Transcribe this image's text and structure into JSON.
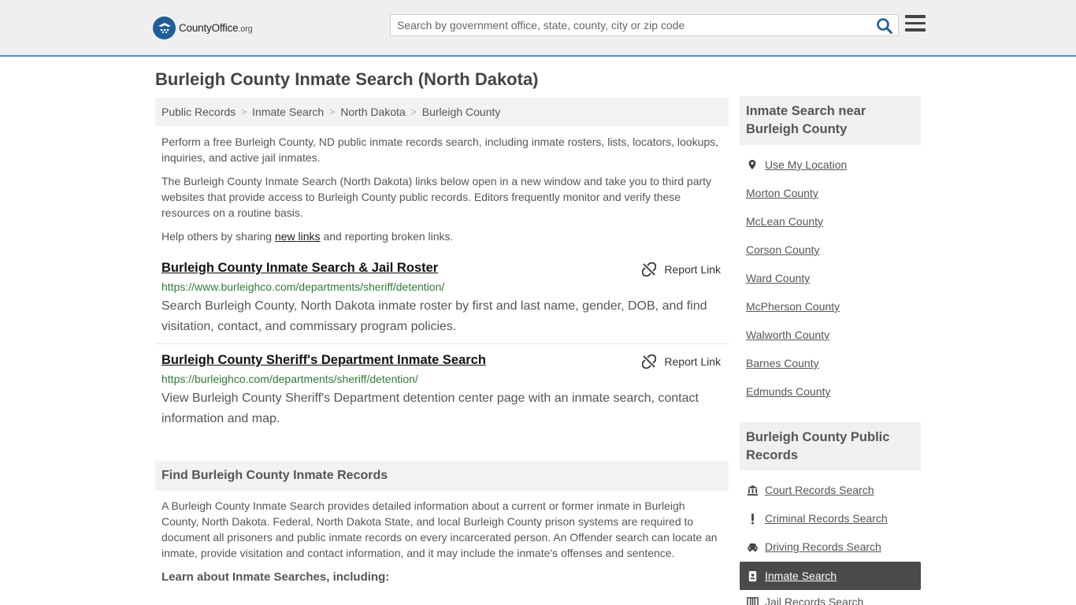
{
  "header": {
    "logo_main": "CountyOffice",
    "logo_tld": ".org",
    "search_placeholder": "Search by government office, state, county, city or zip code"
  },
  "page_title": "Burleigh County Inmate Search (North Dakota)",
  "breadcrumb": [
    "Public Records",
    "Inmate Search",
    "North Dakota",
    "Burleigh County"
  ],
  "intro": {
    "p1": "Perform a free Burleigh County, ND public inmate records search, including inmate rosters, lists, locators, lookups, inquiries, and active jail inmates.",
    "p2": "The Burleigh County Inmate Search (North Dakota) links below open in a new window and take you to third party websites that provide access to Burleigh County public records. Editors frequently monitor and verify these resources on a routine basis.",
    "p3_pre": "Help others by sharing ",
    "p3_link": "new links",
    "p3_post": " and reporting broken links."
  },
  "results": [
    {
      "title": "Burleigh County Inmate Search & Jail Roster",
      "url": "https://www.burleighco.com/departments/sheriff/detention/",
      "desc": "Search Burleigh County, North Dakota inmate roster by first and last name, gender, DOB, and find visitation, contact, and commissary program policies.",
      "report": "Report Link"
    },
    {
      "title": "Burleigh County Sheriff's Department Inmate Search",
      "url": "https://burleighco.com/departments/sheriff/detention/",
      "desc": "View Burleigh County Sheriff's Department detention center page with an inmate search, contact information and map.",
      "report": "Report Link"
    }
  ],
  "find_section": {
    "heading": "Find Burleigh County Inmate Records",
    "text": "A Burleigh County Inmate Search provides detailed information about a current or former inmate in Burleigh County, North Dakota. Federal, North Dakota State, and local Burleigh County prison systems are required to document all prisoners and public inmate records on every incarcerated person. An Offender search can locate an inmate, provide visitation and contact information, and it may include the inmate's offenses and sentence.",
    "learn": "Learn about Inmate Searches, including:"
  },
  "sidebar": {
    "near_heading": "Inmate Search near Burleigh County",
    "use_location": "Use My Location",
    "counties": [
      "Morton County",
      "McLean County",
      "Corson County",
      "Ward County",
      "McPherson County",
      "Walworth County",
      "Barnes County",
      "Edmunds County"
    ],
    "public_heading": "Burleigh County Public Records",
    "public_links": [
      {
        "label": "Court Records Search",
        "icon": "courthouse-icon"
      },
      {
        "label": "Criminal Records Search",
        "icon": "exclamation-icon"
      },
      {
        "label": "Driving Records Search",
        "icon": "car-icon"
      },
      {
        "label": "Inmate Search",
        "icon": "id-badge-icon"
      },
      {
        "label": "Jail Records Search",
        "icon": "jail-icon"
      }
    ]
  },
  "colors": {
    "accent": "#4a90d9",
    "url_green": "#2e7d32",
    "active_bg": "#4a4a4a"
  }
}
